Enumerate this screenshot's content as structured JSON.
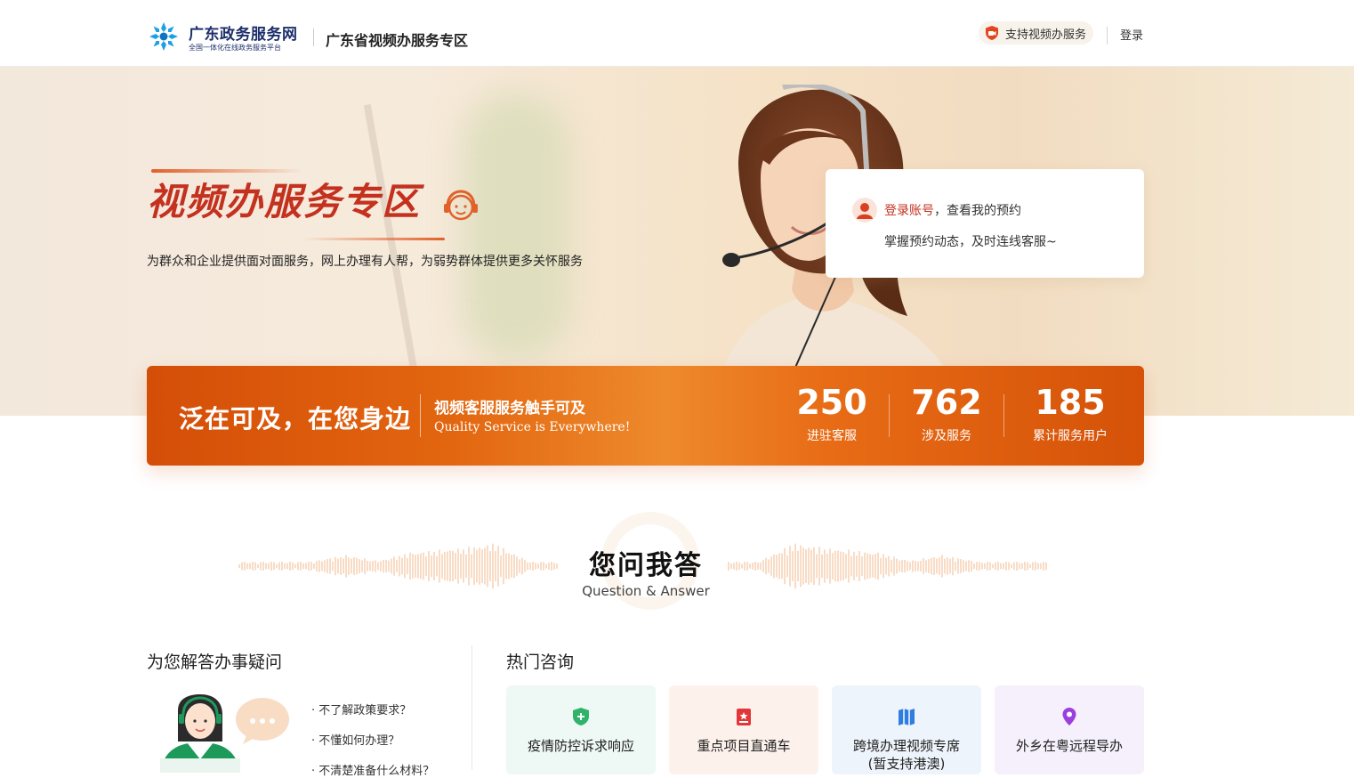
{
  "header": {
    "site_name": "广东政务服务网",
    "site_tagline": "全国一体化在线政务服务平台",
    "zone_title": "广东省视频办服务专区",
    "support_label": "支持视频办服务",
    "login_label": "登录"
  },
  "hero": {
    "title": "视频办服务专区",
    "subtitle": "为群众和企业提供面对面服务，网上办理有人帮，为弱势群体提供更多关怀服务",
    "login_card": {
      "link_text": "登录账号",
      "line1_rest": "，查看我的预约",
      "line2": "掌握预约动态，及时连线客服~"
    }
  },
  "stats_banner": {
    "slogan": "泛在可及，在您身边",
    "sub_cn": "视频客服服务触手可及",
    "sub_en": "Quality Service is Everywhere!",
    "items": [
      {
        "value": "250",
        "label": "进驻客服"
      },
      {
        "value": "762",
        "label": "涉及服务"
      },
      {
        "value": "185",
        "label": "累计服务用户"
      }
    ]
  },
  "qa": {
    "title": "您问我答",
    "subtitle": "Question & Answer"
  },
  "left_panel": {
    "title": "为您解答办事疑问",
    "questions": [
      "· 不了解政策要求？",
      "· 不懂如何办理？",
      "· 不清楚准备什么材料？"
    ]
  },
  "hot": {
    "title": "热门咨询",
    "cards": [
      {
        "label": "疫情防控诉求响应",
        "bg": "#eef8f4",
        "icon_color": "#2fb36b"
      },
      {
        "label": "重点项目直通车",
        "bg": "#fdf1ec",
        "icon_color": "#e2373a"
      },
      {
        "label": "跨境办理视频专席\n(暂支持港澳)",
        "bg": "#eef4fb",
        "icon_color": "#2f7de1"
      },
      {
        "label": "外乡在粤远程导办",
        "bg": "#f5f0fb",
        "icon_color": "#9b3fe0"
      }
    ]
  },
  "colors": {
    "brand_red": "#c4311f",
    "banner_orange": "#e2650f",
    "header_navy": "#1d2f6b"
  }
}
